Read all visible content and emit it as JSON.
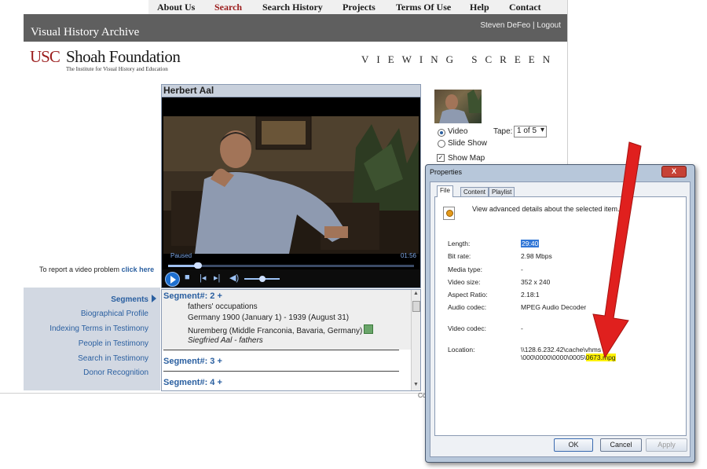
{
  "nav": {
    "items": [
      "About Us",
      "Search",
      "Search History",
      "Projects",
      "Terms Of Use",
      "Help",
      "Contact"
    ],
    "active": "Search"
  },
  "header": {
    "title": "Visual History Archive",
    "user": "Steven DeFeo",
    "separator": " | ",
    "logout": "Logout"
  },
  "logo": {
    "usc": "USC",
    "shoah": "Shoah Foundation",
    "subtitle": "The Institute for Visual History and Education"
  },
  "page_heading": "VIEWING SCREEN",
  "player": {
    "title": "Herbert Aal",
    "status": "Paused",
    "time": "01:56",
    "progress": 0.12,
    "volume": 0.5
  },
  "report": {
    "text": "To report a video problem",
    "link": "click here"
  },
  "left_nav": {
    "segments": "Segments",
    "items": [
      "Biographical Profile",
      "Indexing Terms in Testimony",
      "People in Testimony",
      "Search in Testimony",
      "Donor Recognition"
    ]
  },
  "segments": {
    "seg2": {
      "label": "Segment#: 2 +",
      "lines": [
        "fathers' occupations",
        "Germany 1900 (January 1) - 1939 (August 31)",
        "Nuremberg (Middle Franconia, Bavaria, Germany)"
      ],
      "person": "Siegfried Aal - fathers"
    },
    "seg3": "Segment#: 3 +",
    "seg4": "Segment#: 4 +"
  },
  "view_options": {
    "video": "Video",
    "slideshow": "Slide Show",
    "show_map": "Show Map",
    "tape_label": "Tape:",
    "tape_value": "1 of 5"
  },
  "dialog": {
    "title": "Properties",
    "close": "X",
    "tabs": [
      "File",
      "Content",
      "Playlist"
    ],
    "description": "View advanced details about the selected item.",
    "props": [
      {
        "label": "Length:",
        "value": "29:40"
      },
      {
        "label": "Bit rate:",
        "value": "2.98 Mbps"
      },
      {
        "label": "Media type:",
        "value": "-"
      },
      {
        "label": "Video size:",
        "value": "352 x 240"
      },
      {
        "label": "Aspect Ratio:",
        "value": "2.18:1"
      },
      {
        "label": "Audio codec:",
        "value": "MPEG Audio Decoder"
      },
      {
        "label": "Video codec:",
        "value": "-"
      }
    ],
    "location_label": "Location:",
    "location_line1": "\\\\128.6.232.42\\cache\\vhms",
    "location_line2": "\\000\\0000\\0000\\0005\\",
    "location_file": "0673.mpg",
    "buttons": {
      "ok": "OK",
      "cancel": "Cancel",
      "apply": "Apply"
    }
  },
  "colors": {
    "brand_red": "#9b1c1c",
    "link_blue": "#2a5fa0",
    "highlight": "#fff200",
    "arrow": "#e0201e"
  },
  "peek_text": "Co"
}
